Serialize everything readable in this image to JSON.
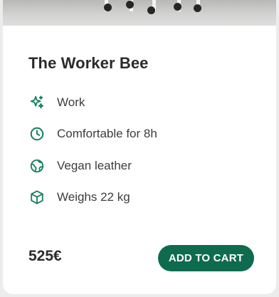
{
  "product": {
    "title": "The Worker Bee",
    "features": [
      {
        "icon": "sparkle-icon",
        "label": "Work"
      },
      {
        "icon": "clock-icon",
        "label": "Comfortable for 8h"
      },
      {
        "icon": "globe-icon",
        "label": "Vegan leather"
      },
      {
        "icon": "box-icon",
        "label": "Weighs 22 kg"
      }
    ],
    "price": "525€",
    "cta_label": "ADD TO CART"
  },
  "colors": {
    "accent": "#0e6b4e",
    "icon": "#17805c",
    "text": "#2b2b2b"
  }
}
